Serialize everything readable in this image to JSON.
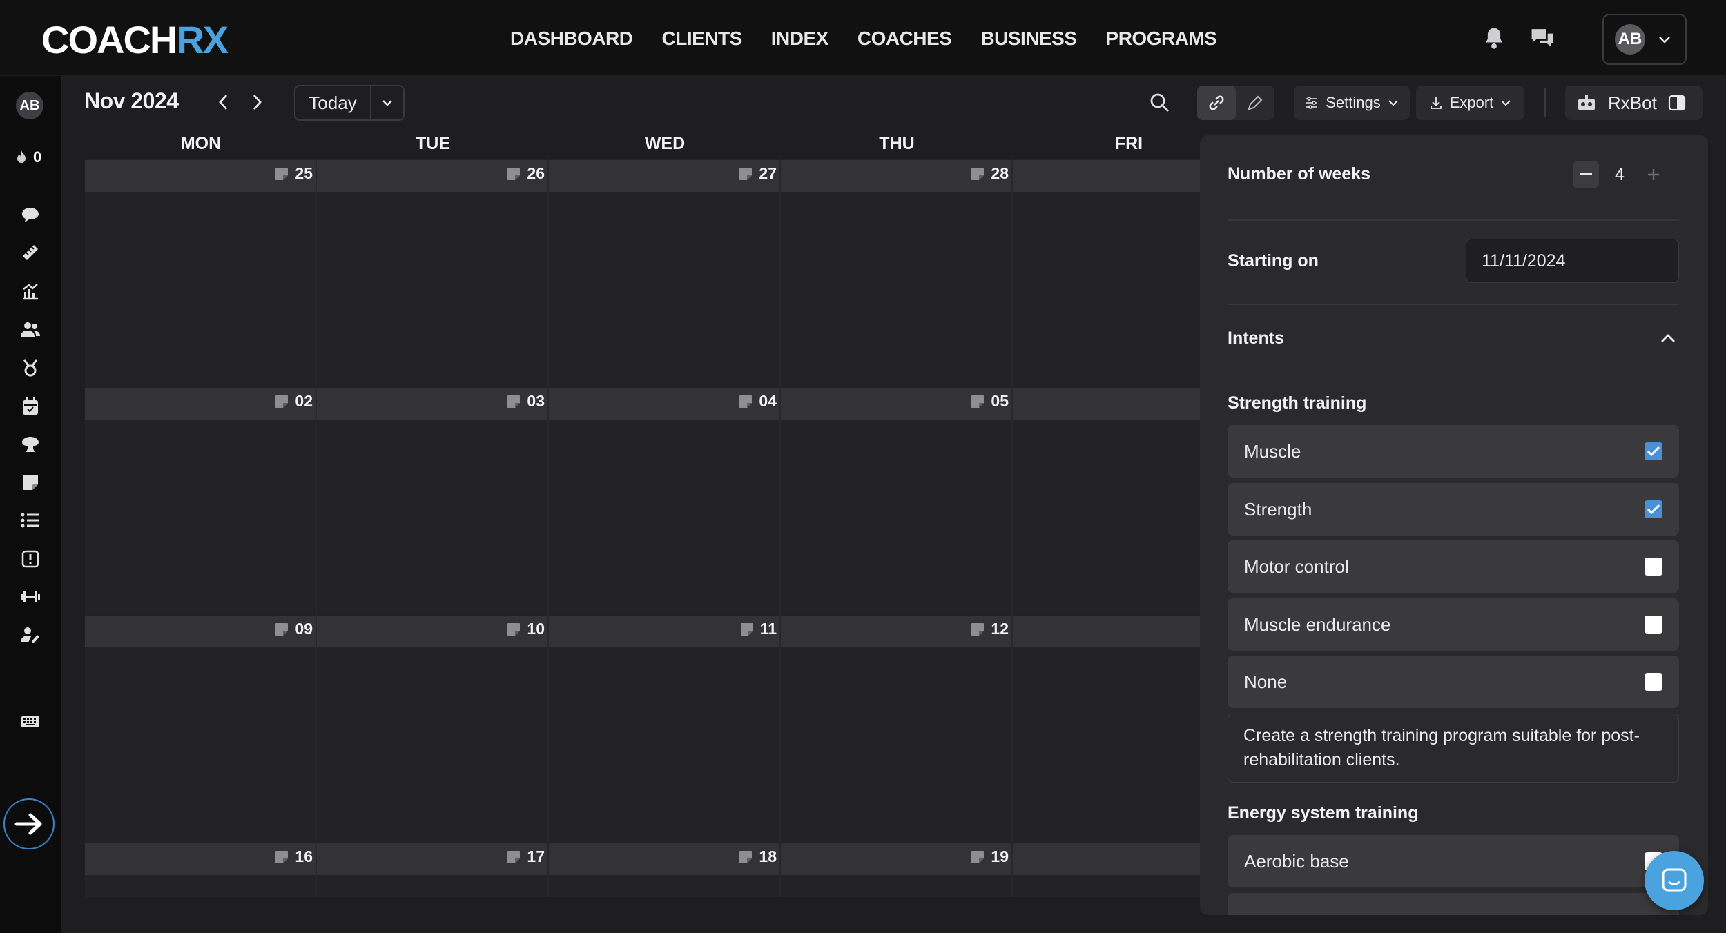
{
  "brand": {
    "logo_main": "COACH",
    "logo_accent": "RX"
  },
  "nav": {
    "items": [
      "DASHBOARD",
      "CLIENTS",
      "INDEX",
      "COACHES",
      "BUSINESS",
      "PROGRAMS"
    ]
  },
  "user": {
    "initials": "AB"
  },
  "sidebar": {
    "avatar_initials": "AB",
    "streak_count": "0"
  },
  "calendar": {
    "month_label": "Nov 2024",
    "today_label": "Today",
    "days": [
      "MON",
      "TUE",
      "WED",
      "THU",
      "FRI"
    ],
    "weeks": [
      [
        "25",
        "26",
        "27",
        "28"
      ],
      [
        "02",
        "03",
        "04",
        "05"
      ],
      [
        "09",
        "10",
        "11",
        "12"
      ],
      [
        "16",
        "17",
        "18",
        "19"
      ]
    ]
  },
  "toolbar": {
    "settings_label": "Settings",
    "export_label": "Export",
    "rxbot_label": "RxBot"
  },
  "panel": {
    "weeks_label": "Number of weeks",
    "weeks_value": "4",
    "starting_label": "Starting on",
    "starting_value": "11/11/2024",
    "intents_label": "Intents",
    "strength_heading": "Strength training",
    "strength_options": [
      {
        "label": "Muscle",
        "checked": true
      },
      {
        "label": "Strength",
        "checked": true
      },
      {
        "label": "Motor control",
        "checked": false
      },
      {
        "label": "Muscle endurance",
        "checked": false
      },
      {
        "label": "None",
        "checked": false
      }
    ],
    "note": "Create a strength training program suitable for post-rehabilitation clients.",
    "energy_heading": "Energy system training",
    "energy_options": [
      {
        "label": "Aerobic base",
        "checked": false
      }
    ]
  },
  "colors": {
    "accent": "#4aa3df",
    "checkbox_checked": "#4a90d9",
    "background": "#1e1e20",
    "panel": "#2a2a2d"
  }
}
